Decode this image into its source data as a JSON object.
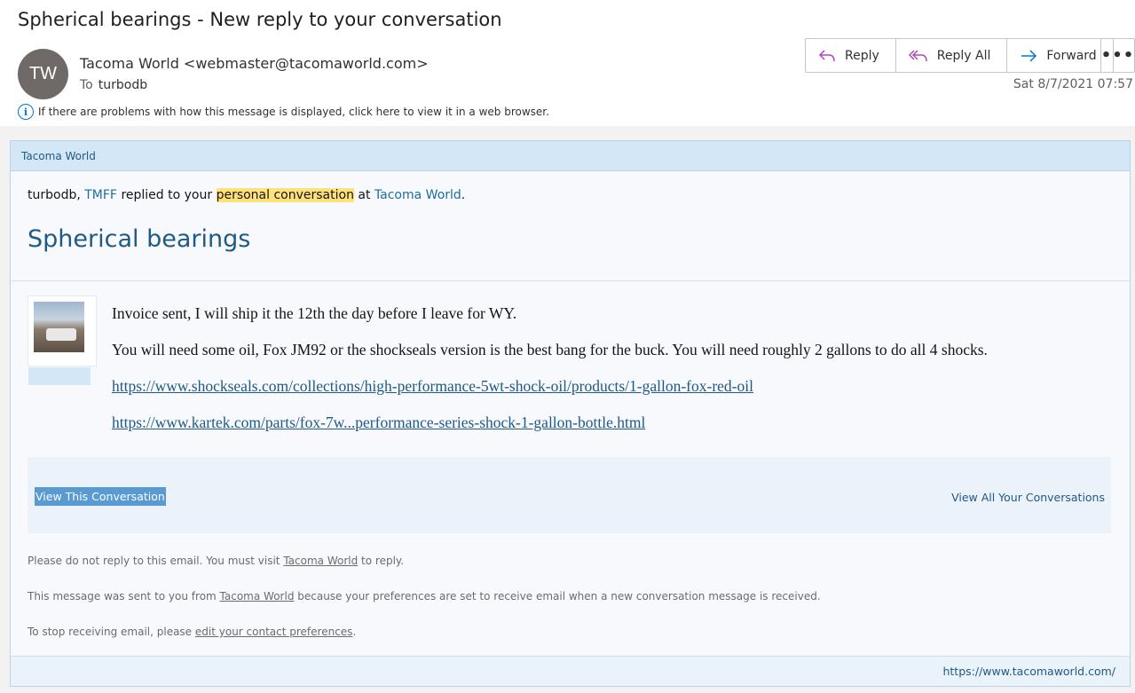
{
  "email": {
    "subject": "Spherical bearings - New reply to your conversation",
    "avatar_initials": "TW",
    "sender": "Tacoma World <webmaster@tacomaworld.com>",
    "to_label": "To",
    "to_name": "turbodb",
    "date": "Sat 8/7/2021 07:57",
    "info_text": "If there are problems with how this message is displayed, click here to view it in a web browser."
  },
  "actions": {
    "reply": "Reply",
    "reply_all": "Reply All",
    "forward": "Forward",
    "more": "•••"
  },
  "card": {
    "header": "Tacoma World",
    "intro": {
      "user": "turbodb, ",
      "replier": "TMFF",
      "replied_text": " replied to your ",
      "highlight": "personal conversation",
      "at_text": " at ",
      "site": "Tacoma World",
      "period": "."
    },
    "title": "Spherical bearings",
    "message": [
      "Invoice sent, I will ship it the 12th the day before I leave for WY.",
      "You will need some oil, Fox JM92 or the shockseals version is the best bang for the buck. You will need roughly 2 gallons to do all 4 shocks."
    ],
    "links": [
      "https://www.shockseals.com/collections/high-performance-5wt-shock-oil/products/1-gallon-fox-red-oil",
      "https://www.kartek.com/parts/fox-7w...performance-series-shock-1-gallon-bottle.html"
    ],
    "view_this": "View This Conversation",
    "view_all": "View All Your Conversations",
    "notes": {
      "n1_pre": "Please do not reply to this email. You must visit ",
      "n1_link": "Tacoma World",
      "n1_post": " to reply.",
      "n2_pre": "This message was sent to you from ",
      "n2_link": "Tacoma World",
      "n2_post": " because your preferences are set to receive email when a new conversation message is received.",
      "n3_pre": "To stop receiving email, please ",
      "n3_link": "edit your contact preferences",
      "n3_post": "."
    },
    "site_url": "https://www.tacomaworld.com/"
  },
  "colors": {
    "accent": "#0078d4",
    "link": "#1e5a85",
    "highlight": "#ffe37a",
    "reply_icon": "#b146c2"
  }
}
